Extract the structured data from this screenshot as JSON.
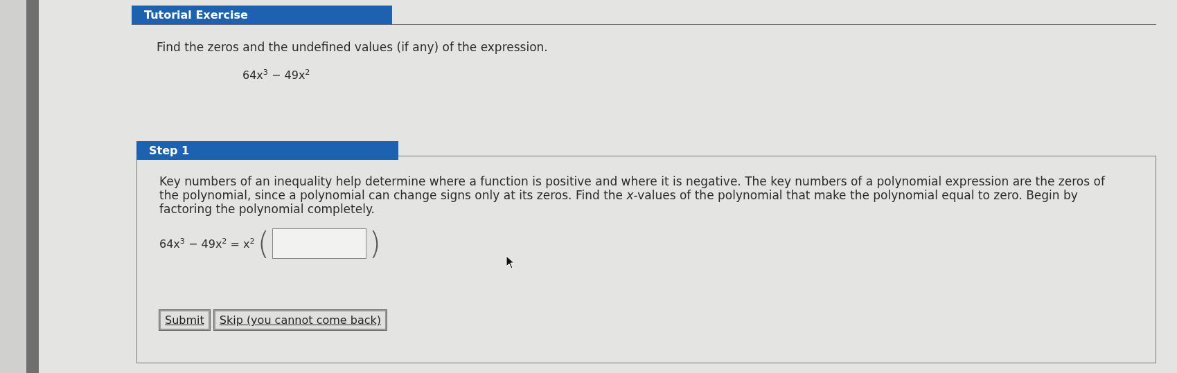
{
  "exercise": {
    "title": "Tutorial Exercise",
    "prompt": "Find the zeros and the undefined values (if any) of the expression.",
    "expression": "64x$^{3}$ − 49x$^{2}$"
  },
  "step": {
    "title": "Step 1",
    "text": "Key numbers of an inequality help determine where a function is positive and where it is negative. The key numbers of a polynomial expression are the zeros of the polynomial, since a polynomial can change signs only at its zeros. Find the *x*-values of the polynomial that make the polynomial equal to zero. Begin by factoring the polynomial completely.",
    "equation_left": "64x$^{3}$ − 49x$^{2}$ = x$^{2}$",
    "open_paren": "(",
    "close_paren": ")",
    "buttons": [
      {
        "label": "Submit"
      },
      {
        "label": "Skip (you cannot come back)"
      }
    ]
  }
}
